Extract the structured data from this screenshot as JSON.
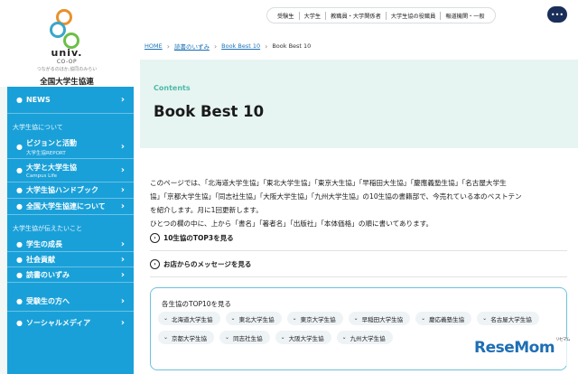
{
  "logo": {
    "mark": "univ.",
    "sub": "CO-OP",
    "tagline": "つながるのほか,協同のみらい",
    "org": "全国大学生協連"
  },
  "sidebar": {
    "top_items": [
      {
        "label": "NEWS"
      }
    ],
    "section1": "大学生協について",
    "section1_items": [
      {
        "label": "ビジョンと活動",
        "sub": "大学生協REPORT"
      },
      {
        "label": "大学と大学生協",
        "sub": "Campus Life"
      },
      {
        "label": "大学生協ハンドブック",
        "sub": ""
      },
      {
        "label": "全国大学生協連について",
        "sub": ""
      }
    ],
    "section2": "大学生協が伝えたいこと",
    "section2_items": [
      {
        "label": "学生の成長"
      },
      {
        "label": "社会貢献"
      },
      {
        "label": "読書のいずみ"
      }
    ],
    "bottom_items": [
      {
        "label": "受験生の方へ"
      },
      {
        "label": "ソーシャルメディア"
      }
    ]
  },
  "topnav": {
    "items": [
      "受験生",
      "大学生",
      "教職員・大学関係者",
      "大学生協の役職員",
      "報道機関・一般"
    ],
    "menu_icon": "more-dots-icon"
  },
  "breadcrumb": {
    "items": [
      "HOME",
      "読書のいずみ",
      "Book Best 10"
    ],
    "current": "Book Best 10"
  },
  "hero": {
    "eyebrow": "Contents",
    "title": "Book Best 10"
  },
  "intro": {
    "line1": "このページでは、「北海道大学生協」「東北大学生協」「東京大生協」「早稲田大生協」「慶應義塾生協」「名古屋大学生",
    "line2": "協」「京都大学生協」「同志社生協」「大阪大学生協」「九州大学生協」の10生協の書籍部で、今売れている本のベストテン",
    "line3": "を紹介します。月に1回更新します。",
    "line4": "ひとつの欄の中に、上から「書名」「著者名」「出版社」「本体価格」の順に書いてあります。"
  },
  "links": {
    "top3": "10生協のTOP3を見る",
    "message": "お店からのメッセージを見る"
  },
  "ranking": {
    "title": "各生協のTOP10を見る",
    "tags": [
      "北海道大学生協",
      "東北大学生協",
      "東京大学生協",
      "早稲田大学生協",
      "慶応義塾生協",
      "名古屋大学生協",
      "京都大学生協",
      "同志社生協",
      "大阪大学生協",
      "九州大学生協"
    ]
  },
  "watermark": {
    "text": "ReseMom",
    "kana": "リセマム"
  },
  "colors": {
    "sidebar_blue": "#1aa0d8",
    "hero_bg": "#e6f5f2",
    "accent_teal": "#4fb8a8",
    "link_blue": "#1a73b8"
  }
}
